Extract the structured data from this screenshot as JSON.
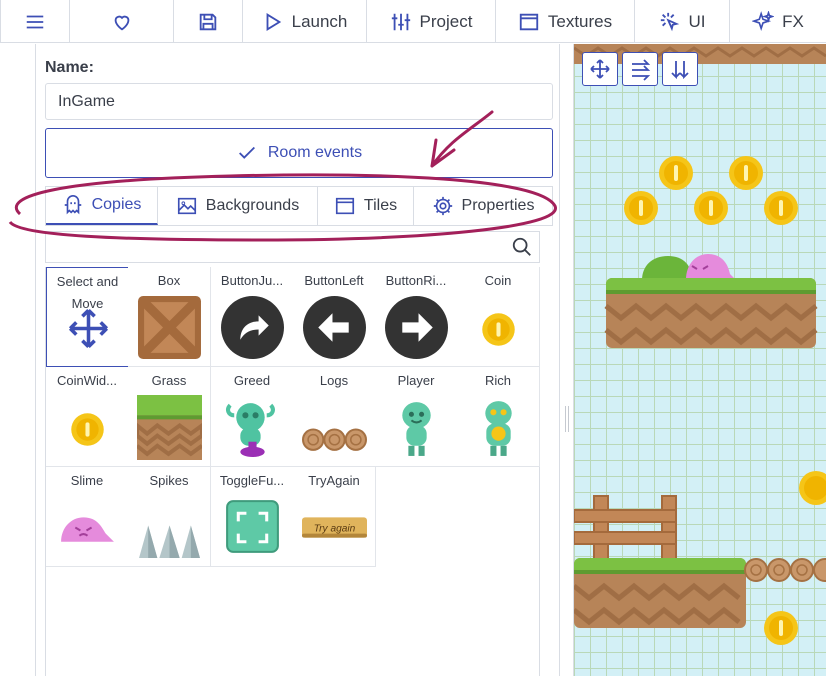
{
  "toolbar": {
    "menu_icon": "hamburger-icon",
    "favorite_icon": "heart-icon",
    "save_icon": "save-icon",
    "launch_label": "Launch",
    "project_label": "Project",
    "textures_label": "Textures",
    "ui_label": "UI",
    "fx_label": "FX"
  },
  "room": {
    "name_label": "Name:",
    "name_value": "InGame",
    "events_label": "Room events"
  },
  "tabs": [
    {
      "label": "Copies",
      "icon": "ghost-icon",
      "active": true
    },
    {
      "label": "Backgrounds",
      "icon": "image-icon",
      "active": false
    },
    {
      "label": "Tiles",
      "icon": "tiles-icon",
      "active": false
    },
    {
      "label": "Properties",
      "icon": "gear-icon",
      "active": false
    }
  ],
  "search": {
    "placeholder": "",
    "icon": "search-icon"
  },
  "copies": [
    {
      "name": "Select and Move",
      "icon": "move-arrows-icon"
    },
    {
      "name": "Box",
      "icon": "crate-icon"
    },
    {
      "name": "ButtonJu...",
      "icon": "jump-button-icon"
    },
    {
      "name": "ButtonLeft",
      "icon": "left-button-icon"
    },
    {
      "name": "ButtonRi...",
      "icon": "right-button-icon"
    },
    {
      "name": "Coin",
      "icon": "coin-icon"
    },
    {
      "name": "CoinWid...",
      "icon": "coin-icon"
    },
    {
      "name": "Grass",
      "icon": "grass-tile-icon"
    },
    {
      "name": "Greed",
      "icon": "greed-monster-icon"
    },
    {
      "name": "Logs",
      "icon": "logs-icon"
    },
    {
      "name": "Player",
      "icon": "player-icon"
    },
    {
      "name": "Rich",
      "icon": "rich-monster-icon"
    },
    {
      "name": "Slime",
      "icon": "slime-icon"
    },
    {
      "name": "Spikes",
      "icon": "spikes-icon"
    },
    {
      "name": "ToggleFu...",
      "icon": "fullscreen-toggle-icon"
    },
    {
      "name": "TryAgain",
      "icon": "try-again-button-icon"
    }
  ],
  "tryagain_text": "Try again",
  "game_controls": [
    {
      "icon": "move-icon"
    },
    {
      "icon": "swap-horizontal-icon"
    },
    {
      "icon": "swap-vertical-icon"
    }
  ],
  "colors": {
    "accent": "#3d4fb5",
    "annotation": "#a3205a",
    "grid_bg": "#d3f0f6"
  }
}
